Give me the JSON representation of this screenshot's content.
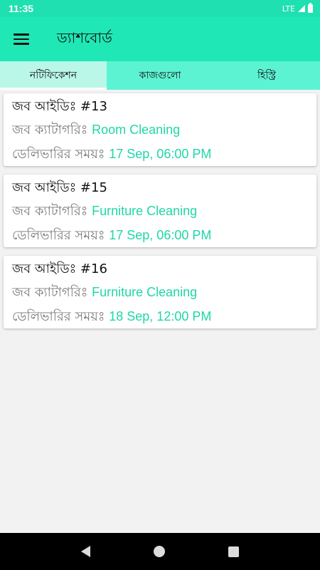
{
  "status_bar": {
    "time": "11:35",
    "network": "LTE"
  },
  "app_bar": {
    "title": "ড্যাশবোর্ড"
  },
  "tabs": [
    {
      "label": "নটিফিকেশন",
      "active": true
    },
    {
      "label": "কাজগুলো",
      "active": false
    },
    {
      "label": "হিস্ট্রি",
      "active": false
    }
  ],
  "jobs": [
    {
      "id_label": "জব আইডিঃ #13",
      "category_label": "জব ক্যাটাগরিঃ",
      "category": "Room Cleaning",
      "delivery_label": "ডেলিভারির সময়ঃ",
      "delivery_time": "17 Sep, 06:00 PM"
    },
    {
      "id_label": "জব আইডিঃ #15",
      "category_label": "জব ক্যাটাগরিঃ",
      "category": "Furniture Cleaning",
      "delivery_label": "ডেলিভারির সময়ঃ",
      "delivery_time": "17 Sep, 06:00 PM"
    },
    {
      "id_label": "জব আইডিঃ #16",
      "category_label": "জব ক্যাটাগরিঃ",
      "category": "Furniture Cleaning",
      "delivery_label": "ডেলিভারির সময়ঃ",
      "delivery_time": "18 Sep, 12:00 PM"
    }
  ],
  "colors": {
    "primary": "#1fe7b5",
    "accent_text": "#1fd6a8",
    "tab_bar": "#5cf3d3"
  },
  "icons": {
    "menu": "hamburger-menu-icon",
    "back": "back-triangle-icon",
    "home": "home-circle-icon",
    "recents": "recents-square-icon"
  }
}
